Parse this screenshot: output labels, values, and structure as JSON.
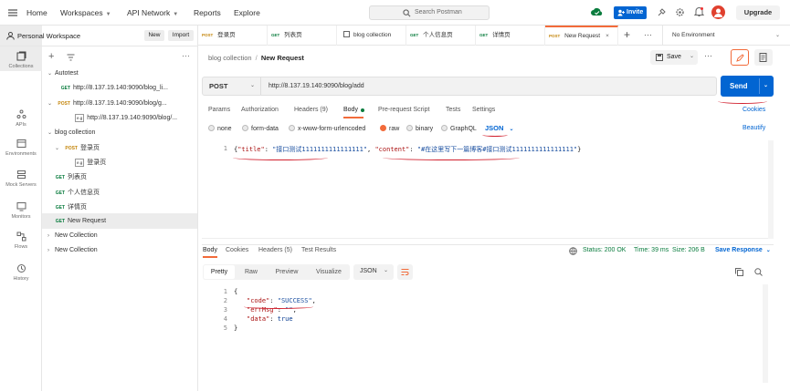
{
  "topnav": {
    "home": "Home",
    "workspaces": "Workspaces",
    "api_network": "API Network",
    "reports": "Reports",
    "explore": "Explore",
    "search_placeholder": "Search Postman",
    "invite": "Invite",
    "upgrade": "Upgrade"
  },
  "rail": [
    {
      "label": "Collections"
    },
    {
      "label": "APIs"
    },
    {
      "label": "Environments"
    },
    {
      "label": "Mock Servers"
    },
    {
      "label": "Monitors"
    },
    {
      "label": "Flows"
    },
    {
      "label": "History"
    }
  ],
  "sidebar": {
    "workspace": "Personal Workspace",
    "new_btn": "New",
    "import_btn": "Import",
    "tree": [
      {
        "label": "Autotest",
        "method": "",
        "arrow": "⌄"
      },
      {
        "label": "http://8.137.19.140:9090/blog_li...",
        "method": "GET",
        "arrow": ""
      },
      {
        "label": "http://8.137.19.140:9090/blog/g...",
        "method": "POST",
        "arrow": "⌄"
      },
      {
        "label": "http://8.137.19.140:9090/blog/...",
        "method": "e.g",
        "arrow": ""
      },
      {
        "label": "blog collection",
        "method": "",
        "arrow": "⌄"
      },
      {
        "label": "登录页",
        "method": "POST",
        "arrow": "⌄"
      },
      {
        "label": "登录页",
        "method": "e.g",
        "arrow": ""
      },
      {
        "label": "列表页",
        "method": "GET",
        "arrow": ""
      },
      {
        "label": "个人信息页",
        "method": "GET",
        "arrow": ""
      },
      {
        "label": "详情页",
        "method": "GET",
        "arrow": ""
      },
      {
        "label": "New Request",
        "method": "GET",
        "arrow": ""
      },
      {
        "label": "New Collection",
        "method": "",
        "arrow": "›"
      },
      {
        "label": "New Collection",
        "method": "",
        "arrow": "›"
      }
    ]
  },
  "tabs": [
    {
      "method": "POST",
      "label": "登录页"
    },
    {
      "method": "GET",
      "label": "列表页"
    },
    {
      "method": "",
      "label": "blog collection"
    },
    {
      "method": "GET",
      "label": "个人信息页"
    },
    {
      "method": "GET",
      "label": "详情页"
    },
    {
      "method": "POST",
      "label": "New Request"
    }
  ],
  "environment": "No Environment",
  "breadcrumb": {
    "parent": "blog collection",
    "sep": "/",
    "current": "New Request"
  },
  "save_label": "Save",
  "request": {
    "method": "POST",
    "url": "http://8.137.19.140:9090/blog/add",
    "send": "Send",
    "cookies": "Cookies",
    "beautify": "Beautify"
  },
  "req_tabs": [
    "Params",
    "Authorization",
    "Headers (9)",
    "Body",
    "Pre-request Script",
    "Tests",
    "Settings"
  ],
  "body_types": [
    "none",
    "form-data",
    "x-www-form-urlencoded",
    "raw",
    "binary",
    "GraphQL"
  ],
  "body_format": "JSON",
  "body_code": {
    "line": "1",
    "open": "{",
    "k1": "\"title\"",
    "v1": "\"接口测试1111111111111111\"",
    "k2": "\"content\"",
    "v2": "\"#在这里写下一篇博客#接口测试1111111111111111\"",
    "close": "}"
  },
  "response": {
    "tabs": [
      "Body",
      "Cookies",
      "Headers (5)",
      "Test Results"
    ],
    "status": "Status: 200 OK",
    "time": "Time: 39 ms",
    "size": "Size: 206 B",
    "save": "Save Response",
    "views": [
      "Pretty",
      "Raw",
      "Preview",
      "Visualize"
    ],
    "format": "JSON",
    "lines": [
      "1",
      "2",
      "3",
      "4",
      "5"
    ],
    "open": "{",
    "k_code": "\"code\"",
    "v_code": "\"SUCCESS\"",
    "k_err": "\"errMsg\"",
    "v_err": "\"\"",
    "k_data": "\"data\"",
    "v_data": "true",
    "close": "}"
  }
}
